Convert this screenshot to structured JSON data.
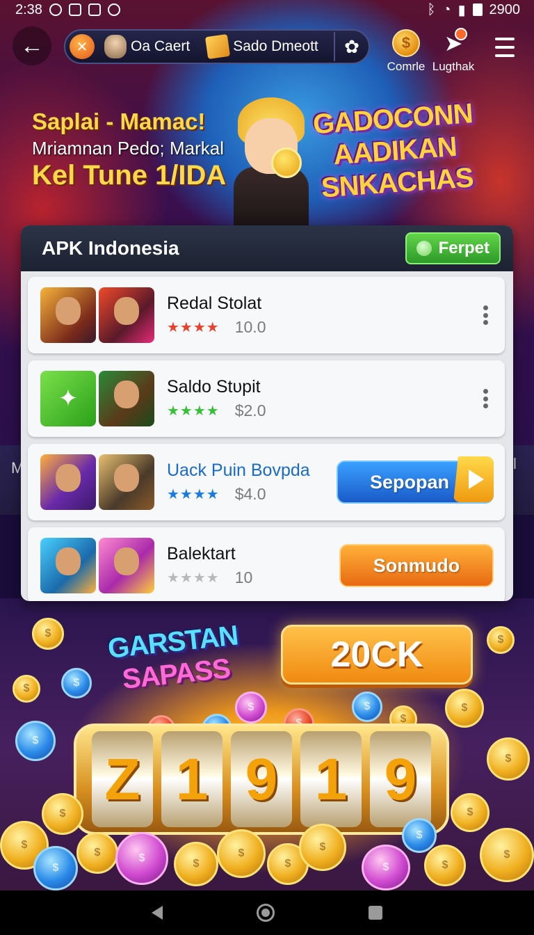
{
  "status_bar": {
    "time": "2:38",
    "right_text": "2900"
  },
  "header": {
    "back_icon": "arrow-left-icon",
    "pill": {
      "player_label": "Oa Caert",
      "balance_label": "Sado Dmeott"
    },
    "actions": [
      {
        "label": "Comrle",
        "icon": "coin-icon"
      },
      {
        "label": "Lugthak",
        "icon": "paper-plane-icon"
      }
    ]
  },
  "hero": {
    "line1": "Saplai - Mamac!",
    "line2": "Mriamnan Pedo; Markal",
    "line3": "Kel Tune 1/IDA",
    "title_lines": [
      "GADOCONN",
      "AADIKAN",
      "SNKACHAS"
    ]
  },
  "panel": {
    "title": "APK Indonesia",
    "header_button": "Ferpet",
    "apps": [
      {
        "name": "Redal Stolat",
        "stars": "★★★★",
        "price": "10.0",
        "action": "more"
      },
      {
        "name": "Saldo Stυpit",
        "stars": "★★★★",
        "price": "$2.0",
        "action": "more"
      },
      {
        "name": "Uack Puin Bovpda",
        "stars": "★★★★",
        "price": "$4.0",
        "action": "Sepopan"
      },
      {
        "name": "Balektart",
        "stars": "★★★★",
        "price": "10",
        "action": "Sonmudo"
      }
    ]
  },
  "side_tiles": {
    "left": "M",
    "right": "l"
  },
  "promo": {
    "logo_line1": "GARSTAN",
    "logo_line2": "SAPASS",
    "claim_label": "20CK",
    "reels": [
      "Z",
      "1",
      "9",
      "1",
      "9"
    ]
  },
  "colors": {
    "accent_orange": "#f08a10",
    "accent_blue": "#1a5ac8",
    "accent_green": "#2c9a28",
    "panel_header": "#1c2231"
  }
}
